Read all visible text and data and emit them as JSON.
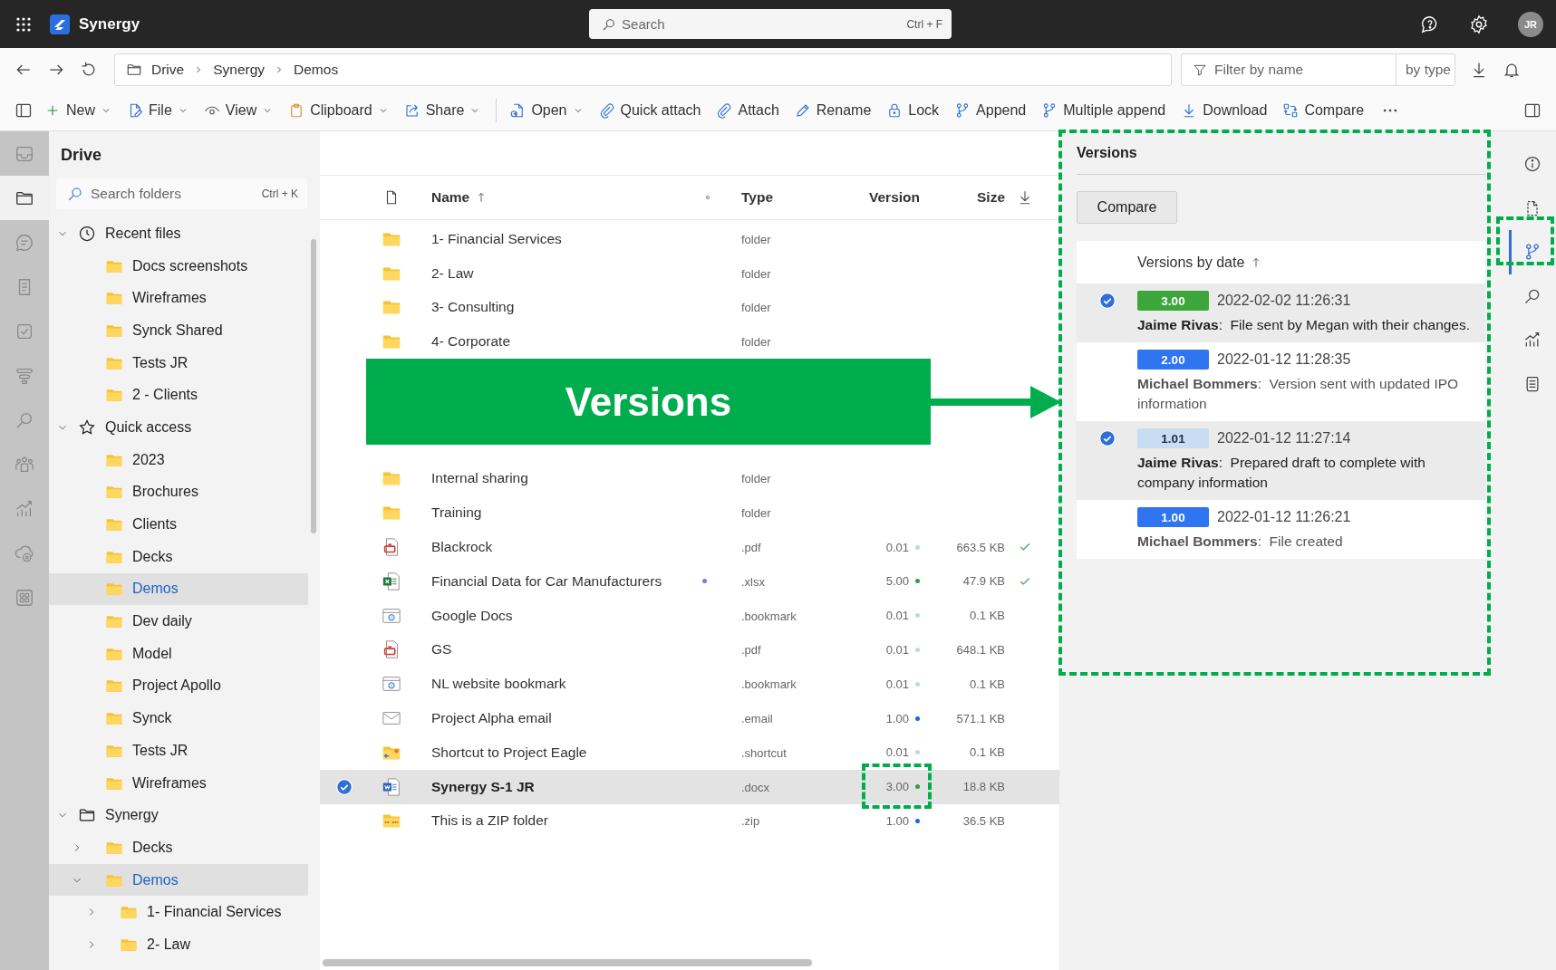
{
  "app": {
    "name": "Synergy"
  },
  "search": {
    "placeholder": "Search",
    "shortcut": "Ctrl + F"
  },
  "user": {
    "initials": "JR"
  },
  "breadcrumb": [
    "Drive",
    "Synergy",
    "Demos"
  ],
  "filter": {
    "placeholder": "Filter by name",
    "type_placeholder": "by type"
  },
  "toolbar": [
    {
      "label": "New",
      "dropdown": true,
      "separator_before": false
    },
    {
      "label": "File",
      "dropdown": true,
      "separator_before": false
    },
    {
      "label": "View",
      "dropdown": true,
      "separator_before": false
    },
    {
      "label": "Clipboard",
      "dropdown": true,
      "separator_before": false
    },
    {
      "label": "Share",
      "dropdown": true,
      "separator_before": false
    },
    {
      "label": "Open",
      "dropdown": true,
      "separator_before": true
    },
    {
      "label": "Quick attach",
      "dropdown": false,
      "separator_before": false
    },
    {
      "label": "Attach",
      "dropdown": false,
      "separator_before": false
    },
    {
      "label": "Rename",
      "dropdown": false,
      "separator_before": false
    },
    {
      "label": "Lock",
      "dropdown": false,
      "separator_before": false
    },
    {
      "label": "Append",
      "dropdown": false,
      "separator_before": false
    },
    {
      "label": "Multiple append",
      "dropdown": false,
      "separator_before": false
    },
    {
      "label": "Download",
      "dropdown": false,
      "separator_before": false
    },
    {
      "label": "Compare",
      "dropdown": false,
      "separator_before": false
    }
  ],
  "left_rail": [
    {
      "selected": false
    },
    {
      "selected": true
    },
    {
      "selected": false
    },
    {
      "selected": false
    },
    {
      "selected": false
    },
    {
      "selected": false
    },
    {
      "selected": false
    },
    {
      "selected": false
    },
    {
      "selected": false
    },
    {
      "selected": false
    },
    {
      "selected": false
    }
  ],
  "sidebar": {
    "title": "Drive",
    "search_placeholder": "Search folders",
    "search_shortcut": "Ctrl + K",
    "tree": [
      {
        "label": "Recent files",
        "expanded": true,
        "selected": false,
        "children": [
          {
            "label": "Docs screenshots",
            "selected": false
          },
          {
            "label": "Wireframes",
            "selected": false
          },
          {
            "label": "Synck Shared",
            "selected": false
          },
          {
            "label": "Tests JR",
            "selected": false
          },
          {
            "label": "2 - Clients",
            "selected": false
          }
        ]
      },
      {
        "label": "Quick access",
        "expanded": true,
        "selected": false,
        "children": [
          {
            "label": "2023",
            "selected": false
          },
          {
            "label": "Brochures",
            "selected": false
          },
          {
            "label": "Clients",
            "selected": false
          },
          {
            "label": "Decks",
            "selected": false
          },
          {
            "label": "Demos",
            "selected": true
          },
          {
            "label": "Dev daily",
            "selected": false
          },
          {
            "label": "Model",
            "selected": false
          },
          {
            "label": "Project Apollo",
            "selected": false
          },
          {
            "label": "Synck",
            "selected": false
          },
          {
            "label": "Tests JR",
            "selected": false
          },
          {
            "label": "Wireframes",
            "selected": false
          }
        ]
      },
      {
        "label": "Synergy",
        "expanded": true,
        "selected": false,
        "children": [
          {
            "label": "Decks",
            "expanded": false,
            "selected": false
          },
          {
            "label": "Demos",
            "expanded": true,
            "selected": true,
            "children": [
              {
                "label": "1- Financial Services",
                "expanded": false,
                "selected": false
              },
              {
                "label": "2- Law",
                "expanded": false,
                "selected": false
              }
            ]
          }
        ]
      }
    ]
  },
  "table": {
    "columns": [
      {
        "label": "Name"
      },
      {
        "label": "Type"
      },
      {
        "label": "Version"
      },
      {
        "label": "Size"
      }
    ],
    "rows": [
      {
        "name": "1- Financial Services",
        "type": "folder",
        "kind": "folder",
        "selected": false
      },
      {
        "name": "2- Law",
        "type": "folder",
        "kind": "folder",
        "selected": false
      },
      {
        "name": "3- Consulting",
        "type": "folder",
        "kind": "folder",
        "selected": false
      },
      {
        "name": "4- Corporate",
        "type": "folder",
        "kind": "folder",
        "selected": false
      },
      {
        "name": "Internal sharing",
        "type": "folder",
        "kind": "folder",
        "selected": false
      },
      {
        "name": "Training",
        "type": "folder",
        "kind": "folder",
        "selected": false
      },
      {
        "name": "Blackrock",
        "type": ".pdf",
        "kind": "pdf",
        "version": "0.01",
        "color": "#bcd6f2",
        "size": "663.5 KB",
        "synced": true,
        "selected": false
      },
      {
        "name": "Financial Data for Car Manufacturers",
        "type": ".xlsx",
        "kind": "xlsx",
        "version": "5.00",
        "color": "#2f9e44",
        "size": "47.9 KB",
        "synced": true,
        "flagged": true,
        "selected": false
      },
      {
        "name": "Google Docs",
        "type": ".bookmark",
        "kind": "bookmark",
        "version": "0.01",
        "color": "#bcd6f2",
        "size": "0.1 KB",
        "synced": false,
        "selected": false
      },
      {
        "name": "GS",
        "type": ".pdf",
        "kind": "pdf",
        "version": "0.01",
        "color": "#bcd6f2",
        "size": "648.1 KB",
        "synced": false,
        "selected": false
      },
      {
        "name": "NL website bookmark",
        "type": ".bookmark",
        "kind": "bookmark",
        "version": "0.01",
        "color": "#bcd6f2",
        "size": "0.1 KB",
        "synced": false,
        "selected": false
      },
      {
        "name": "Project Alpha email",
        "type": ".email",
        "kind": "email",
        "version": "1.00",
        "color": "#1a66e8",
        "size": "571.1 KB",
        "synced": false,
        "selected": false
      },
      {
        "name": "Shortcut to Project Eagle",
        "type": ".shortcut",
        "kind": "shortcut",
        "version": "0.01",
        "color": "#bcd6f2",
        "size": "0.1 KB",
        "synced": false,
        "selected": false
      },
      {
        "name": "Synergy S-1 JR",
        "type": ".docx",
        "kind": "docx",
        "version": "3.00",
        "color": "#2f9e44",
        "size": "18.8 KB",
        "synced": false,
        "selected": true
      },
      {
        "name": "This is a ZIP folder",
        "type": ".zip",
        "kind": "zip",
        "version": "1.00",
        "color": "#1a66e8",
        "size": "36.5 KB",
        "synced": false,
        "selected": false
      }
    ]
  },
  "versions": {
    "title": "Versions",
    "compare_button": "Compare",
    "list_header": "Versions by date",
    "items": [
      {
        "version": "3.00",
        "color": "#3da63a",
        "date": "2022-02-02 11:26:31",
        "comment": "**Jaime Rivas**:  File sent by Megan with their changes.",
        "selected": true
      },
      {
        "version": "2.00",
        "color": "#2f74f0",
        "date": "2022-01-12 11:28:35",
        "comment": "**Michael Bommers**:  Version sent with updated IPO information",
        "selected": false
      },
      {
        "version": "1.01",
        "color": "#c8ddf3",
        "date": "2022-01-12 11:27:14",
        "comment": "**Jaime Rivas**:  Prepared draft to complete with company information",
        "selected": true
      },
      {
        "version": "1.00",
        "color": "#2f74f0",
        "date": "2022-01-12 11:26:21",
        "comment": "**Michael Bommers**:  File created",
        "selected": false
      }
    ]
  },
  "right_rail": [
    {
      "selected": false
    },
    {
      "selected": false
    },
    {
      "selected": true
    },
    {
      "selected": false
    },
    {
      "selected": false
    },
    {
      "selected": false
    }
  ],
  "annotation": {
    "label": "Versions"
  }
}
